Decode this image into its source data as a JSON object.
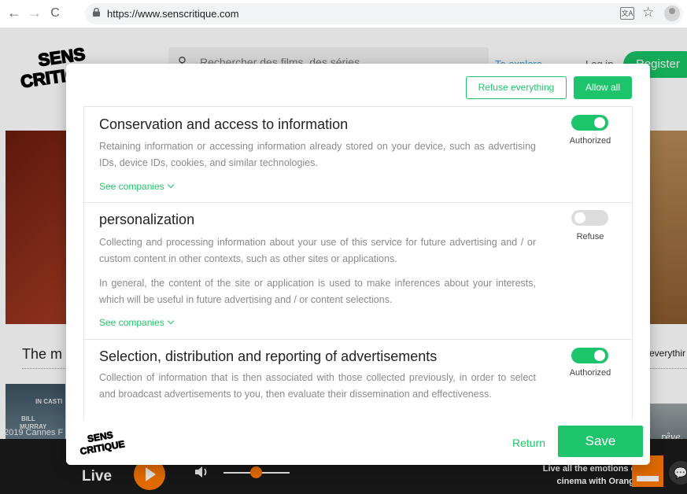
{
  "browser": {
    "back": "←",
    "forward": "→",
    "reload": "C",
    "url": "https://www.senscritique.com",
    "translate_icon": "translate-icon",
    "star_icon": "star-icon",
    "profile_icon": "profile-icon"
  },
  "site": {
    "logo_line1": "SENS",
    "logo_line2": "CRITIQUE",
    "search_placeholder": "Rechercher des films, des séries",
    "to_explore": "To explore",
    "log_in": "Log in",
    "register": "Register",
    "section_title": "The m",
    "section_right": "everythir",
    "poster_left_lines": [
      "IN CASTI",
      "BILL",
      "MURRAY"
    ],
    "poster_right_text": "rêve.",
    "event_text": "2019 Cannes F",
    "player": {
      "live": "Live",
      "promo_line1": "Live all the emotions of",
      "promo_line2": "cinema with Orange",
      "volume_level": 0.45
    }
  },
  "modal": {
    "refuse_all": "Refuse everything",
    "allow_all": "Allow all",
    "purposes": [
      {
        "title": "Conservation and access to information",
        "description": [
          "Retaining information or accessing information already stored on your device, such as advertising IDs, device IDs, cookies, and similar technologies."
        ],
        "see_companies": "See companies",
        "enabled": true,
        "status": "Authorized"
      },
      {
        "title": "personalization",
        "description": [
          "Collecting and processing information about your use of this service for future advertising and / or custom content in other contexts, such as other sites or applications.",
          "In general, the content of the site or application is used to make inferences about your interests, which will be useful in future advertising and / or content selections."
        ],
        "see_companies": "See companies",
        "enabled": false,
        "status": "Refuse"
      },
      {
        "title": "Selection, distribution and reporting of advertisements",
        "description": [
          "Collection of information that is then associated with those collected previously, in order to select and broadcast advertisements to you, then evaluate their dissemination and effectiveness."
        ],
        "enabled": true,
        "status": "Authorized"
      }
    ],
    "footer": {
      "logo_line1": "SENS",
      "logo_line2": "CRITIQUE",
      "return": "Return",
      "save": "Save"
    }
  },
  "colors": {
    "accent": "#1ec46b",
    "player_orange": "#ff7900"
  }
}
